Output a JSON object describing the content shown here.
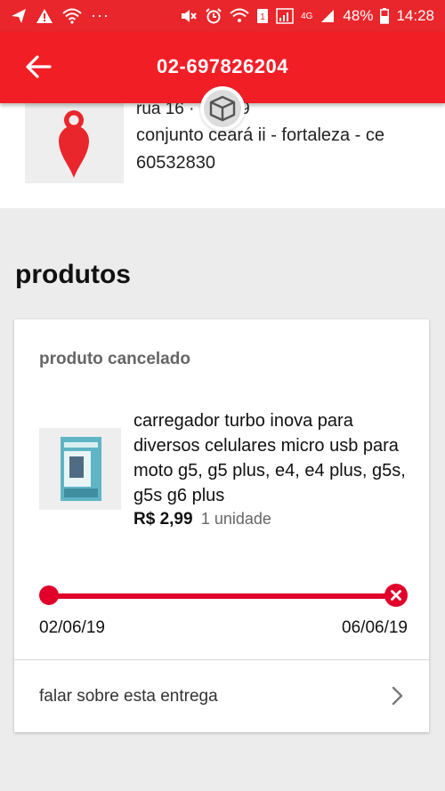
{
  "status_bar": {
    "left_icons": [
      "send-icon",
      "warning-icon",
      "wifi-icon"
    ],
    "dots": "···",
    "right_icons": [
      "mute-icon",
      "alarm-icon",
      "wifi-calling-icon",
      "sim-1-icon",
      "signal-icon",
      "lte-icon"
    ],
    "network": "4G",
    "battery": "48%",
    "time": "14:28"
  },
  "header": {
    "title": "02-697826204",
    "back_icon": "arrow-left-icon",
    "badge_icon": "package-icon"
  },
  "address": {
    "line1": "rua 16 · · · · · 9",
    "line2": "conjunto ceará ii - fortaleza - ce",
    "line3": "60532830",
    "icon": "location-pin-icon"
  },
  "products_section": {
    "title": "produtos"
  },
  "product_card": {
    "status": "produto cancelado",
    "description": "carregador turbo inova para diversos celulares micro usb para moto g5, g5 plus, e4, e4 plus, g5s, g5s g6 plus",
    "price": "R$ 2,99",
    "quantity": "1 unidade",
    "start_date": "02/06/19",
    "end_date": "06/06/19",
    "talk_label": "falar sobre esta entrega"
  },
  "colors": {
    "brand_red": "#f21e26",
    "status_bar_red": "#e8262b",
    "track_red": "#e0002a"
  }
}
